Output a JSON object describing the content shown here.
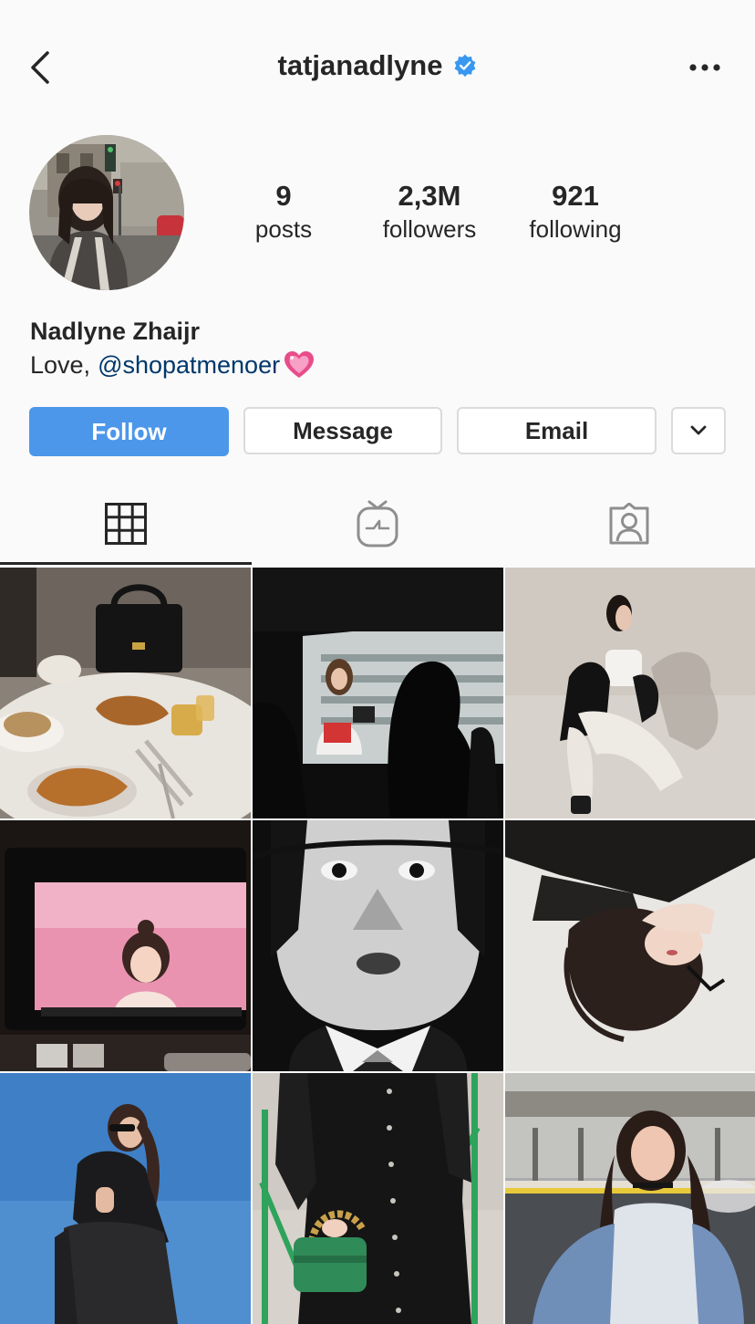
{
  "header": {
    "username": "tatjanadlyne",
    "verified": true,
    "back_icon": "chevron-left-icon",
    "more_icon": "ellipsis-icon"
  },
  "profile": {
    "stats": [
      {
        "value": "9",
        "label": "posts"
      },
      {
        "value": "2,3M",
        "label": "followers"
      },
      {
        "value": "921",
        "label": "following"
      }
    ],
    "name": "Nadlyne Zhaijr",
    "bio_prefix": "Love,",
    "bio_mention": "@shopatmenoer",
    "bio_emoji": "heart-emoji"
  },
  "actions": {
    "follow": "Follow",
    "message": "Message",
    "email": "Email",
    "dropdown_icon": "chevron-down-icon"
  },
  "tabs": [
    {
      "icon": "grid-icon",
      "active": true
    },
    {
      "icon": "igtv-icon",
      "active": false
    },
    {
      "icon": "tagged-icon",
      "active": false
    }
  ],
  "posts": [
    {
      "subject": "breakfast-handbag-photo"
    },
    {
      "subject": "camera-filming-photo"
    },
    {
      "subject": "kneeling-pose-photo"
    },
    {
      "subject": "monitor-screen-photo"
    },
    {
      "subject": "bw-portrait-photo"
    },
    {
      "subject": "lying-down-photo"
    },
    {
      "subject": "blue-sky-pose-photo"
    },
    {
      "subject": "black-dress-green-bag-photo"
    },
    {
      "subject": "street-portrait-photo"
    }
  ],
  "colors": {
    "follow_bg": "#4c97ea",
    "mention": "#00376b",
    "verified": "#3897f0"
  }
}
